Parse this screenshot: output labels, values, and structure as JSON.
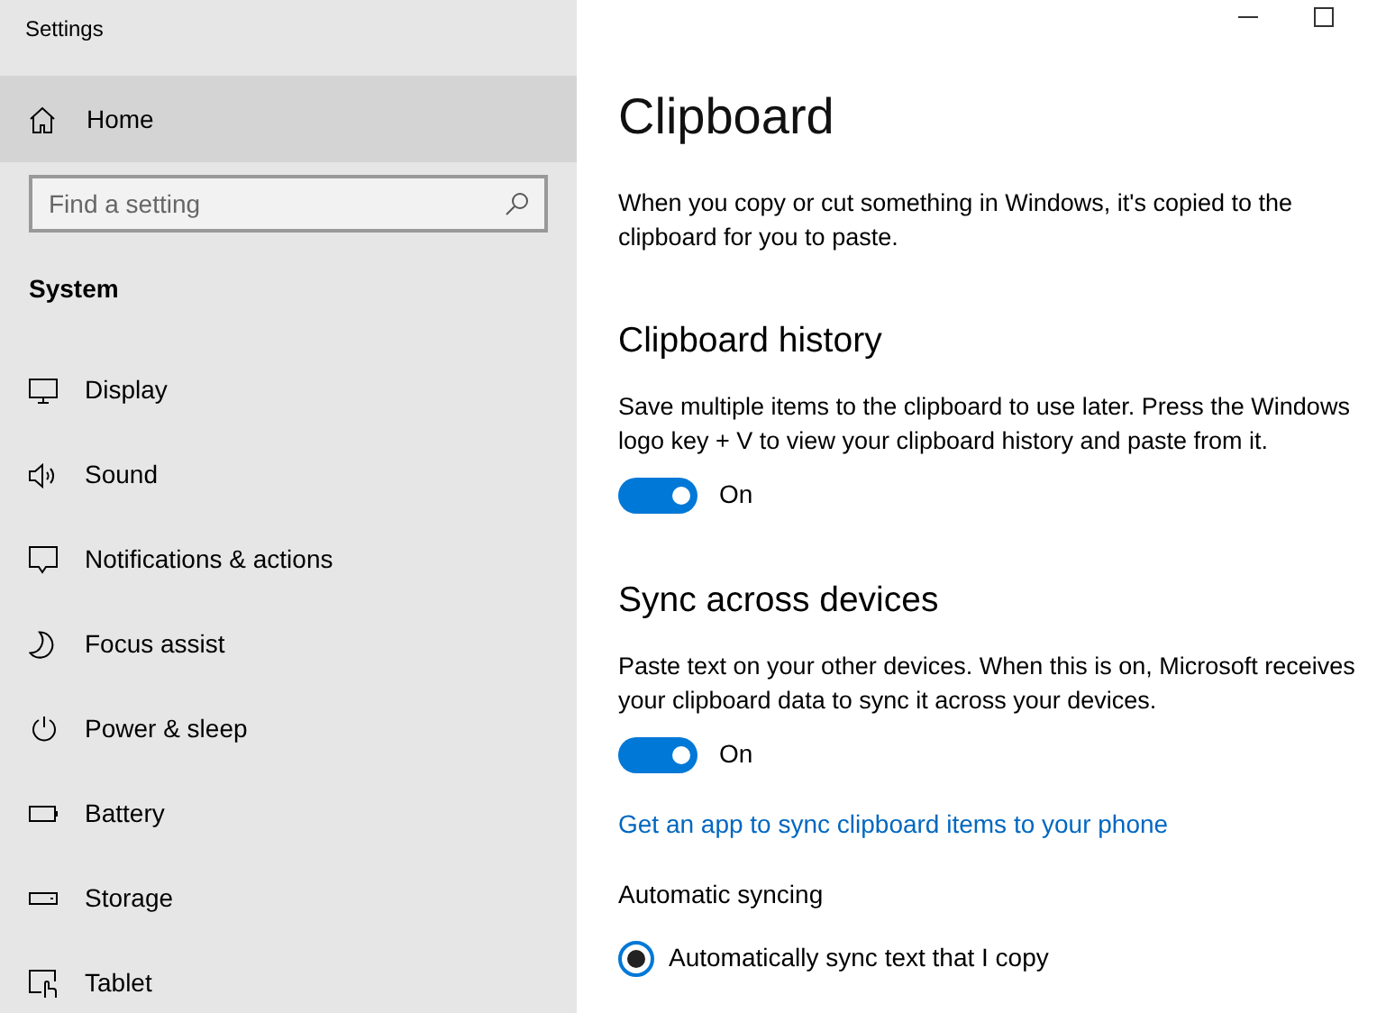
{
  "window": {
    "title": "Settings"
  },
  "sidebar": {
    "home": {
      "label": "Home",
      "highlighted": true
    },
    "search": {
      "placeholder": "Find a setting"
    },
    "section": "System",
    "items": [
      {
        "label": "Display",
        "selected": false
      },
      {
        "label": "Sound",
        "selected": false
      },
      {
        "label": "Notifications & actions",
        "selected": false
      },
      {
        "label": "Focus assist",
        "selected": false
      },
      {
        "label": "Power & sleep",
        "selected": false
      },
      {
        "label": "Battery",
        "selected": false
      },
      {
        "label": "Storage",
        "selected": false
      },
      {
        "label": "Tablet",
        "selected": false
      }
    ]
  },
  "page": {
    "title": "Clipboard",
    "description": "When you copy or cut something in Windows, it's copied to the clipboard for you to paste.",
    "sections": [
      {
        "heading": "Clipboard history",
        "description": "Save multiple items to the clipboard to use later. Press the Windows logo key + V to view your clipboard history and paste from it.",
        "toggle": {
          "on": true,
          "label": "On"
        }
      },
      {
        "heading": "Sync across devices",
        "description": "Paste text on your other devices. When this is on, Microsoft receives your clipboard data to sync it across your devices.",
        "toggle": {
          "on": true,
          "label": "On"
        }
      }
    ],
    "link": "Get an app to sync clipboard items to your phone",
    "group_label": "Automatic syncing",
    "options": [
      {
        "label": "Automatically sync text that I copy",
        "selected": true
      }
    ]
  }
}
